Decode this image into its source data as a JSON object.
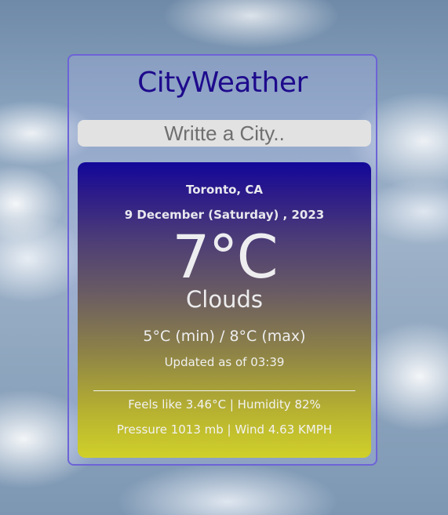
{
  "app": {
    "title": "CityWeather"
  },
  "search": {
    "placeholder": "Writte a City.."
  },
  "weather": {
    "location": "Toronto, CA",
    "date": "9 December (Saturday) , 2023",
    "temperature": "7°C",
    "condition": "Clouds",
    "min_max": "5°C (min) / 8°C (max)",
    "updated": "Updated as of 03:39",
    "feels_humidity": "Feels like 3.46°C | Humidity 82%",
    "pressure_wind": "Pressure 1013 mb | Wind 4.63 KMPH"
  },
  "colors": {
    "title": "#1e0a8c",
    "card_border": "#6d63d6",
    "panel_top": "#12079a",
    "panel_bottom": "#d0d02a",
    "input_bg": "#e2e2e2"
  }
}
